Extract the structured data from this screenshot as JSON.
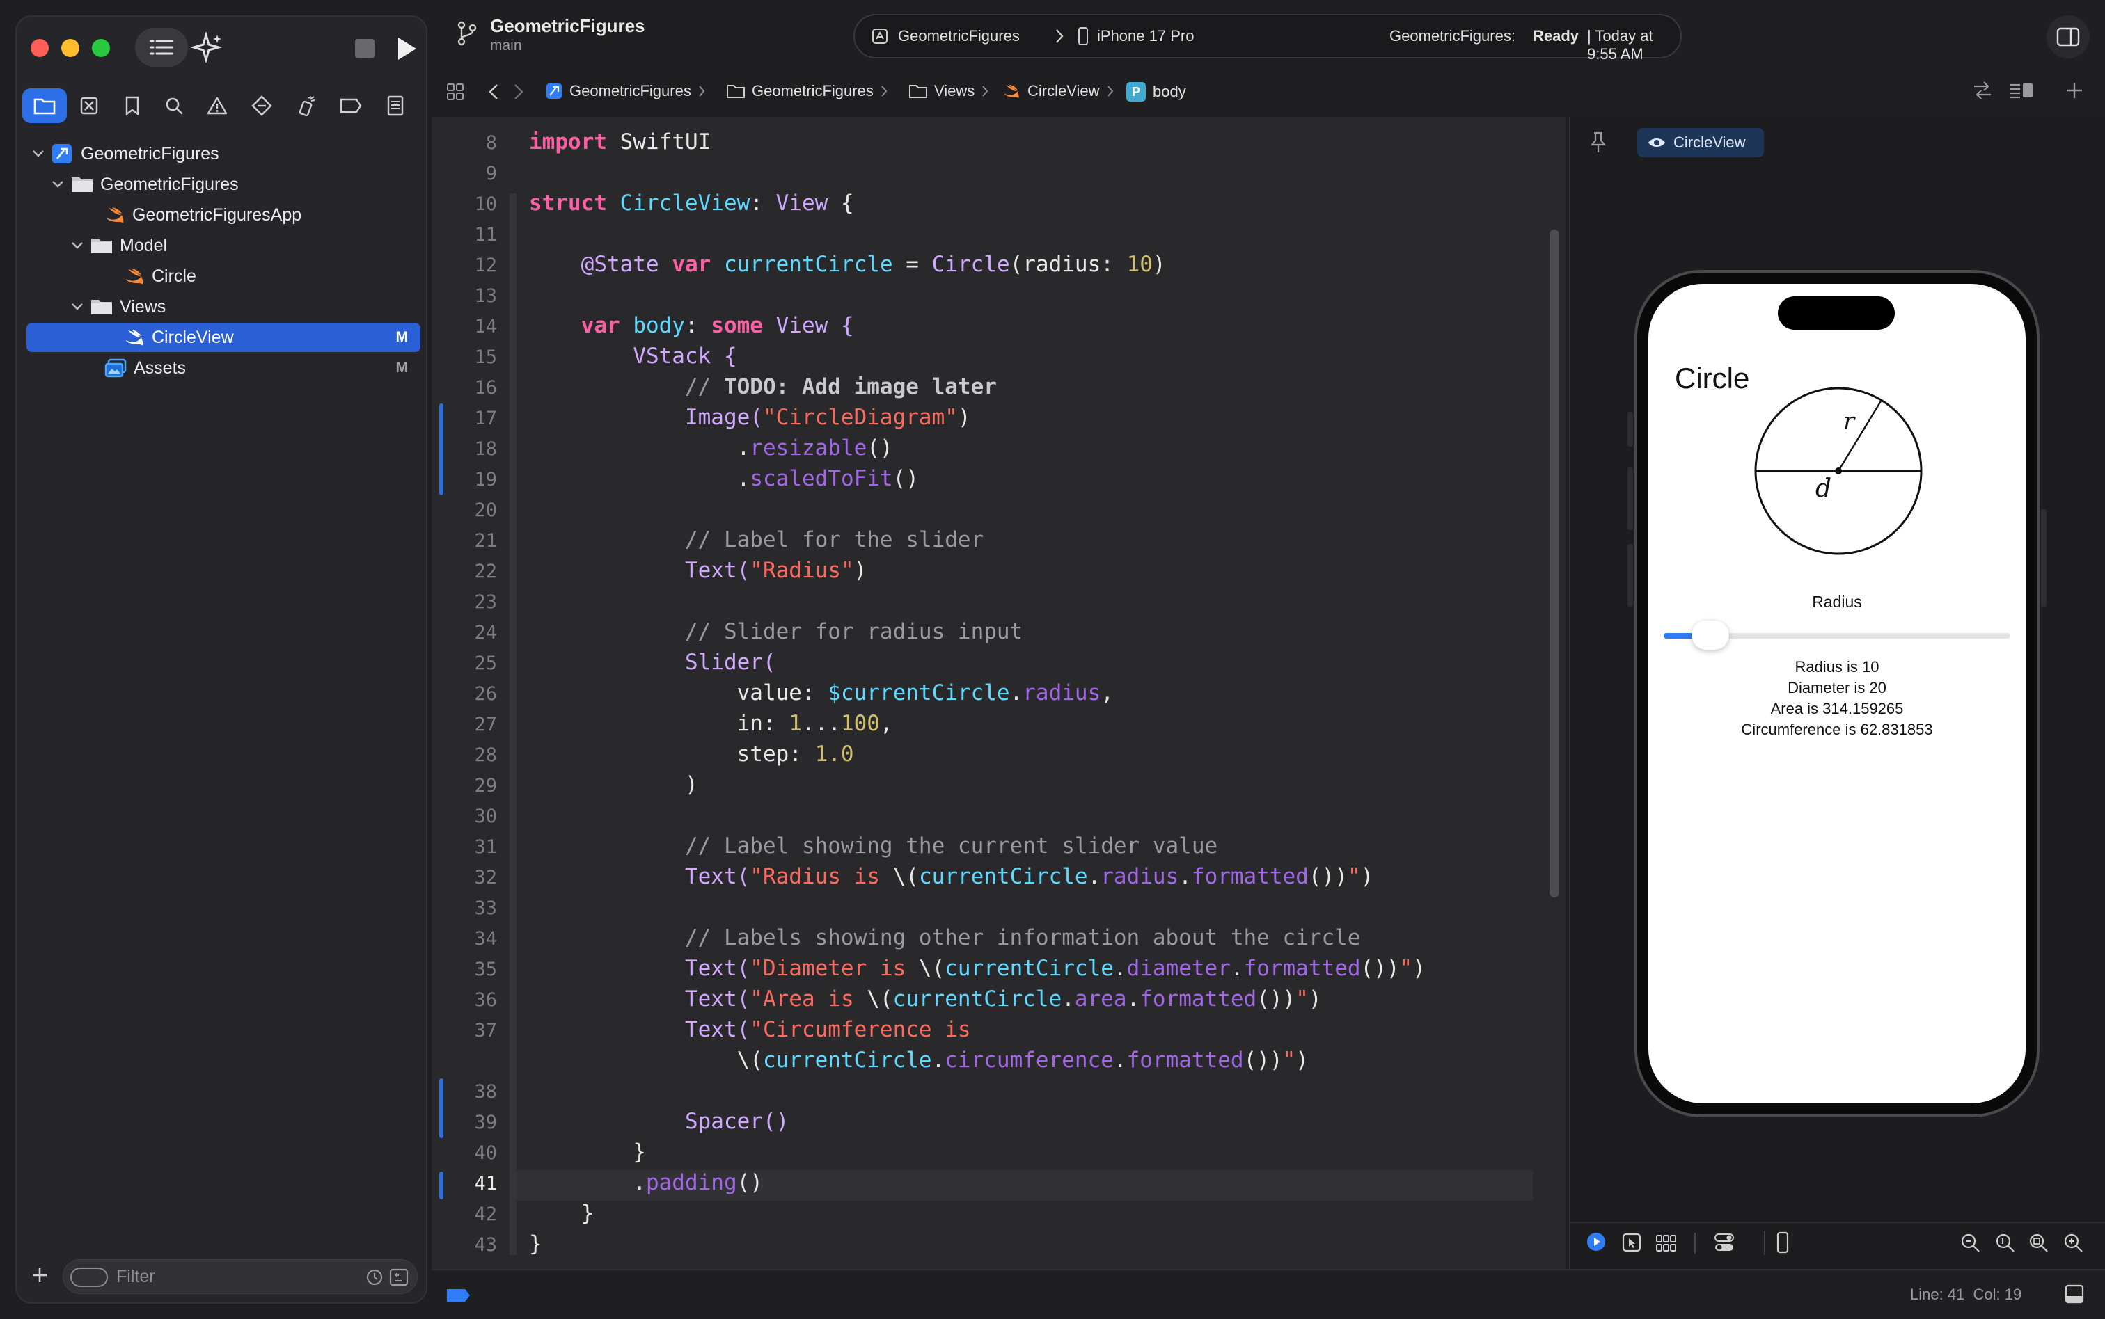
{
  "toolbar": {
    "project": "GeometricFigures",
    "branch": "main",
    "scheme": "GeometricFigures",
    "device": "iPhone 17 Pro",
    "status_prefix": "GeometricFigures:",
    "status_state": "Ready",
    "status_time": "| Today at 9:55 AM"
  },
  "jumpbar": {
    "crumbs": [
      "GeometricFigures",
      "GeometricFigures",
      "Views",
      "CircleView",
      "body"
    ]
  },
  "sidebar": {
    "tree": [
      {
        "label": "GeometricFigures",
        "badge": "",
        "kind": "project"
      },
      {
        "label": "GeometricFigures",
        "badge": "",
        "kind": "folder"
      },
      {
        "label": "GeometricFiguresApp",
        "badge": "",
        "kind": "swift"
      },
      {
        "label": "Model",
        "badge": "",
        "kind": "folder"
      },
      {
        "label": "Circle",
        "badge": "",
        "kind": "swift"
      },
      {
        "label": "Views",
        "badge": "",
        "kind": "folder"
      },
      {
        "label": "CircleView",
        "badge": "M",
        "kind": "swift"
      },
      {
        "label": "Assets",
        "badge": "M",
        "kind": "assets"
      }
    ],
    "filter_placeholder": "Filter"
  },
  "editor": {
    "line_numbers": [
      "8",
      "9",
      "10",
      "11",
      "12",
      "13",
      "14",
      "15",
      "16",
      "17",
      "18",
      "19",
      "20",
      "21",
      "22",
      "23",
      "24",
      "25",
      "26",
      "27",
      "28",
      "29",
      "30",
      "31",
      "32",
      "33",
      "34",
      "35",
      "36",
      "37",
      "38",
      "39",
      "40",
      "41",
      "42",
      "43"
    ],
    "current_line": "41"
  },
  "code": {
    "l8a": "import",
    "l8b": " SwiftUI",
    "l10a": "struct",
    "l10b": "CircleView",
    "l10c": ": ",
    "l10d": "View",
    "l10e": " {",
    "l12a": "@State",
    "l12b": "var",
    "l12c": "currentCircle",
    "l12d": " = ",
    "l12e": "Circle",
    "l12f": "(radius: ",
    "l12g": "10",
    "l12h": ")",
    "l14a": "var",
    "l14b": " body",
    "l14c": ": ",
    "l14d": "some",
    "l14e": " View {",
    "l15": "VStack {",
    "l16a": "// ",
    "l16b": "TODO: Add image later",
    "l17a": "Image(",
    "l17b": "\"CircleDiagram\"",
    "l17c": ")",
    "l18a": ".",
    "l18b": "resizable",
    "l18c": "()",
    "l19a": ".",
    "l19b": "scaledToFit",
    "l19c": "()",
    "l21": "// Label for the slider",
    "l22a": "Text(",
    "l22b": "\"Radius\"",
    "l22c": ")",
    "l24": "// Slider for radius input",
    "l25": "Slider(",
    "l26a": "value: ",
    "l26b": "$currentCircle",
    "l26c": ".",
    "l26d": "radius",
    "l26e": ",",
    "l27a": "in: ",
    "l27b": "1",
    "l27c": "...",
    "l27d": "100",
    "l27e": ",",
    "l28a": "step: ",
    "l28b": "1.0",
    "l29": ")",
    "l31": "// Label showing the current slider value",
    "l32a": "Text(",
    "l32b": "\"Radius is ",
    "l32c": "\\(",
    "l32d": "currentCircle",
    "l32e": ".",
    "l32f": "radius",
    "l32g": ".",
    "l32h": "formatted",
    "l32i": "())",
    "l32j": "\"",
    "l32k": ")",
    "l34": "// Labels showing other information about the circle",
    "l35a": "Text(",
    "l35b": "\"Diameter is ",
    "l35c": "\\(",
    "l35d": "currentCircle",
    "l35e": ".",
    "l35f": "diameter",
    "l35g": ".",
    "l35h": "formatted",
    "l35i": "())",
    "l35j": "\"",
    "l35k": ")",
    "l36a": "Text(",
    "l36b": "\"Area is ",
    "l36c": "\\(",
    "l36d": "currentCircle",
    "l36e": ".",
    "l36f": "area",
    "l36g": ".",
    "l36h": "formatted",
    "l36i": "())",
    "l36j": "\"",
    "l36k": ")",
    "l37a": "Text(",
    "l37b": "\"Circumference is",
    "l37wa": "\\(",
    "l37wb": "currentCircle",
    "l37wc": ".",
    "l37wd": "circumference",
    "l37we": ".",
    "l37wf": "formatted",
    "l37wg": "())",
    "l37wh": "\"",
    "l37wi": ")",
    "l39": "Spacer()",
    "l40": "}",
    "l41a": ".",
    "l41b": "padding",
    "l41c": "()",
    "l42": "}",
    "l43": "}"
  },
  "canvas": {
    "preview_label": "CircleView"
  },
  "preview": {
    "title": "Circle",
    "diagram_r": "r",
    "diagram_d": "d",
    "slider_label": "Radius",
    "slider_fraction": 0.09,
    "radius_text": "Radius is 10",
    "diameter_text": "Diameter is 20",
    "area_text": "Area is 314.159265",
    "circumference_text": "Circumference is 62.831853"
  },
  "statusbar": {
    "position": "Line: 41  Col: 19"
  },
  "colors": {
    "accent": "#2c6fe6",
    "keyword": "#fc5fa3",
    "type": "#5dd8ff",
    "string": "#fc6a5d",
    "number": "#d0bf69"
  }
}
